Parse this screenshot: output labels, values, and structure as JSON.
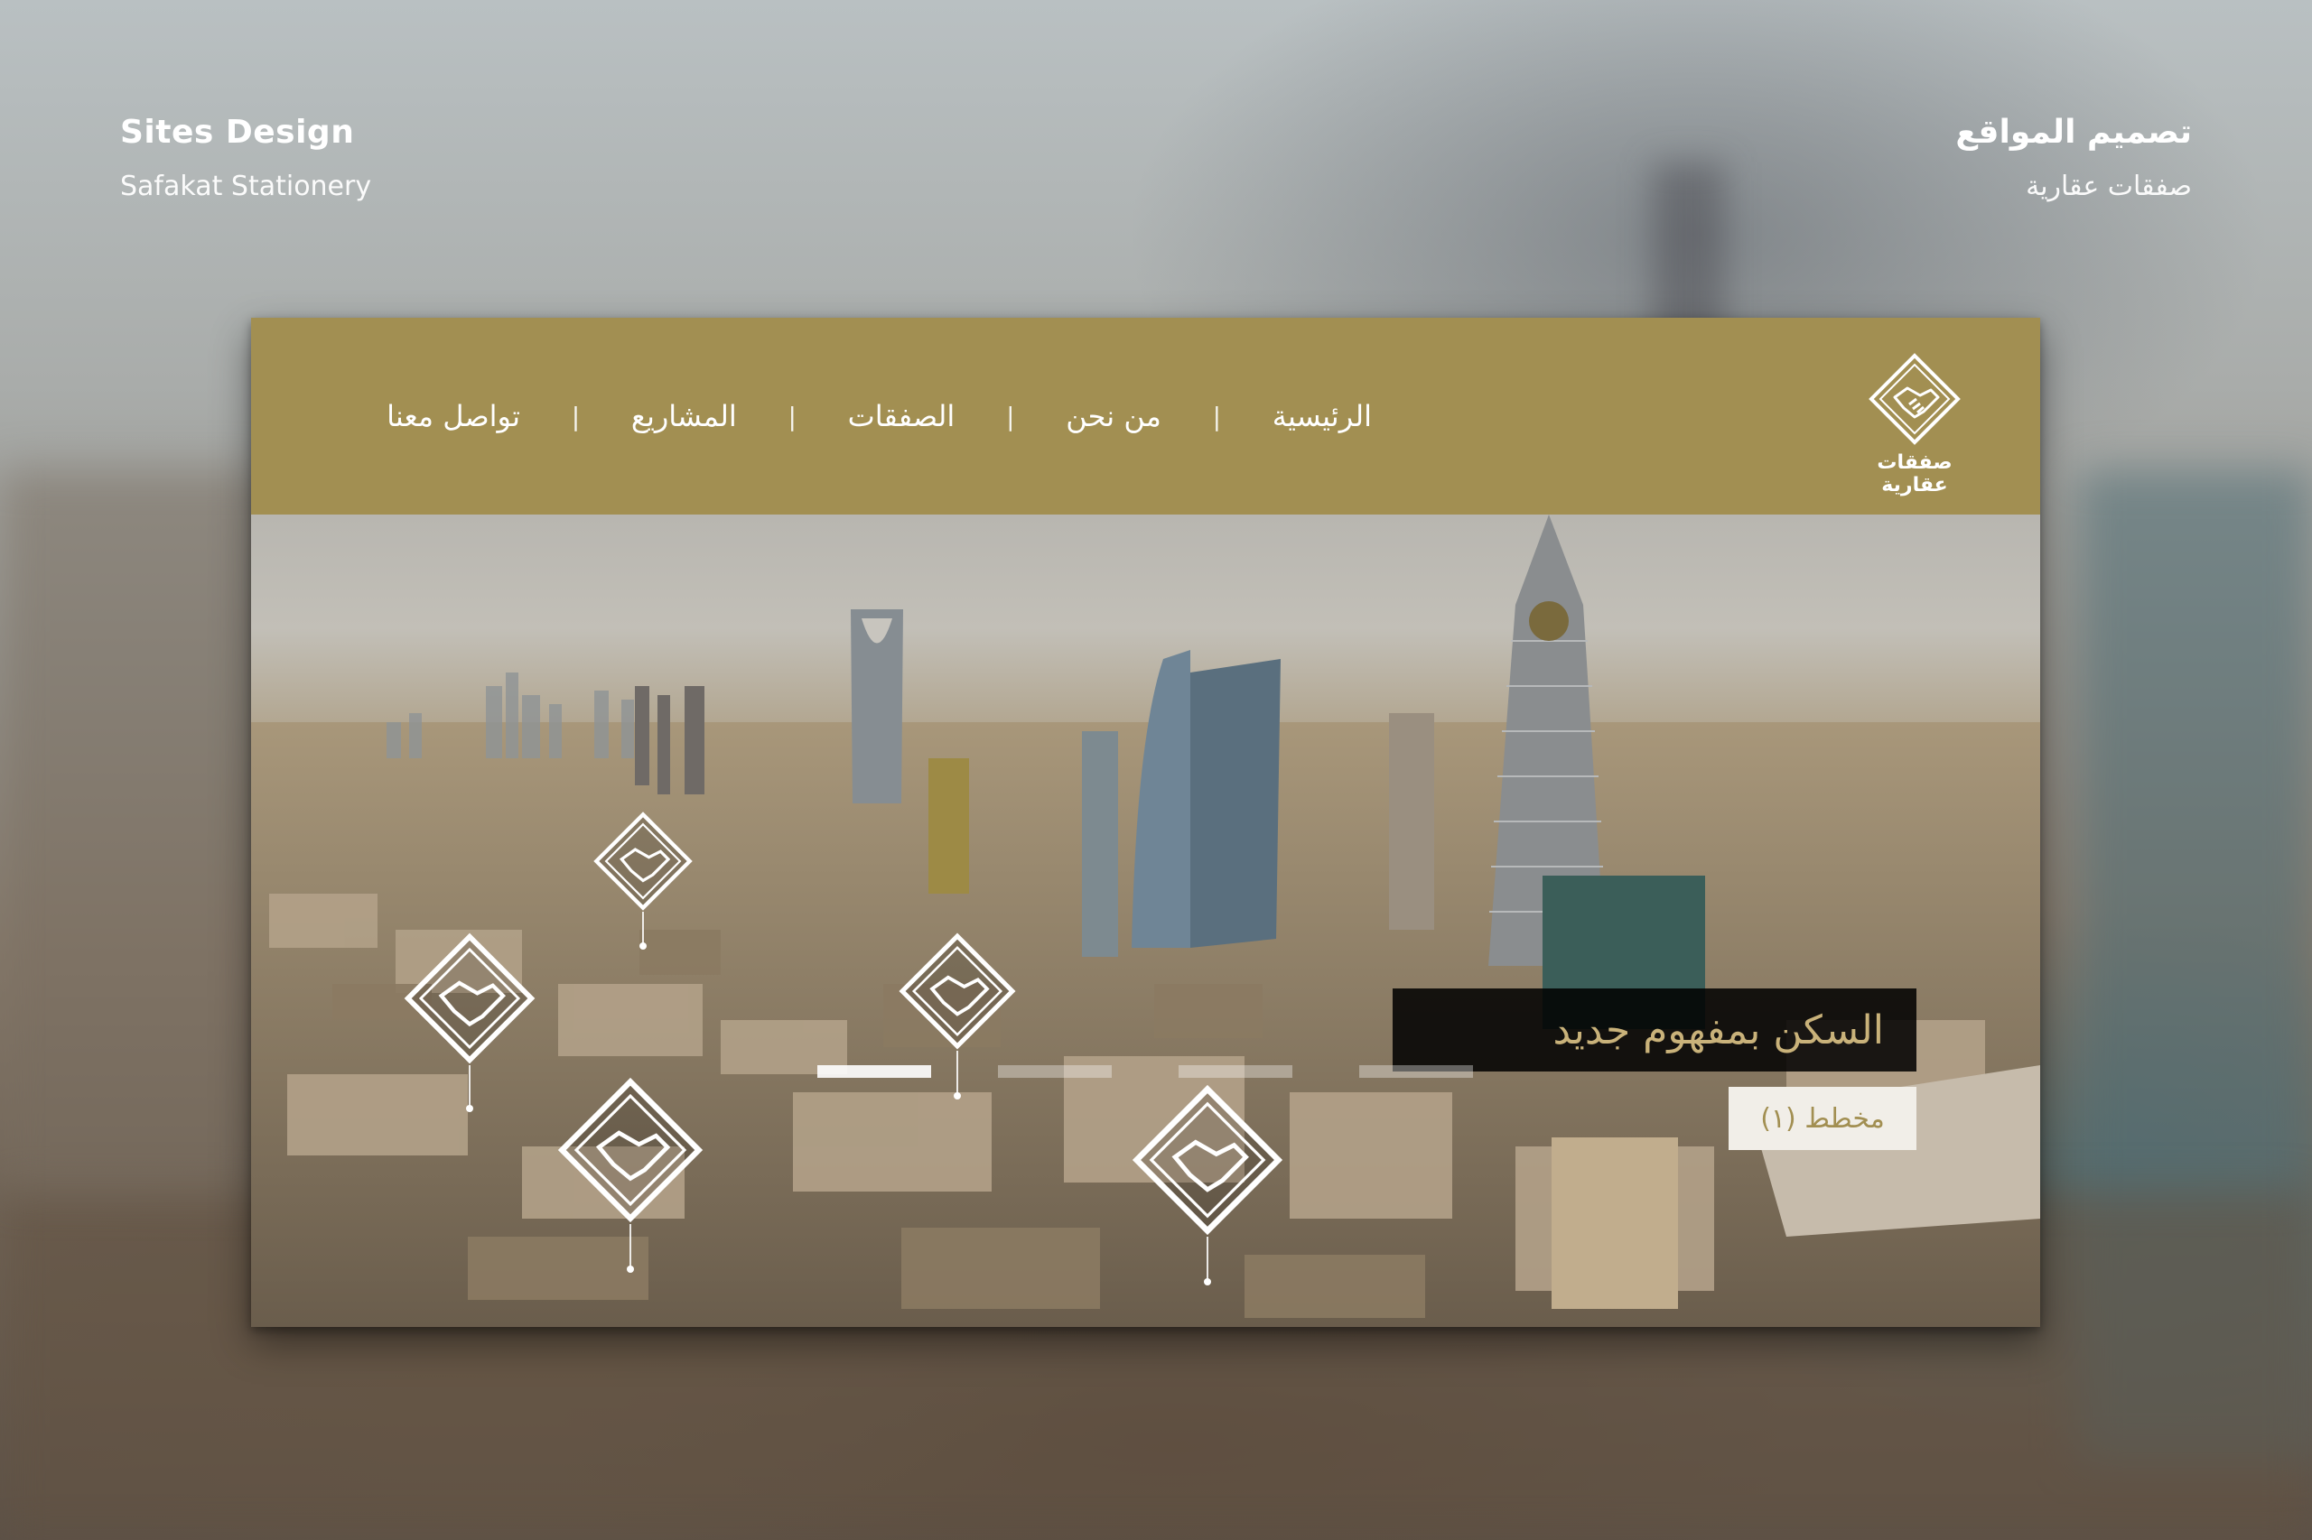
{
  "page": {
    "left_title": "Sites Design",
    "left_subtitle": "Safakat Stationery",
    "right_title": "تصميم المواقع",
    "right_subtitle": "صفقات عقارية"
  },
  "site": {
    "brand_name": "صفقات عقارية",
    "brand_color": "#a28f52",
    "nav": [
      {
        "label": "الرئيسية"
      },
      {
        "label": "من نحن"
      },
      {
        "label": "الصفقات"
      },
      {
        "label": "المشاريع"
      },
      {
        "label": "تواصل معنا"
      }
    ],
    "nav_separator": "|",
    "hero": {
      "headline": "السكن بمفهوم جديد",
      "plan_button": "مخطط (١)",
      "slides": 4,
      "active_slide": 1
    }
  }
}
